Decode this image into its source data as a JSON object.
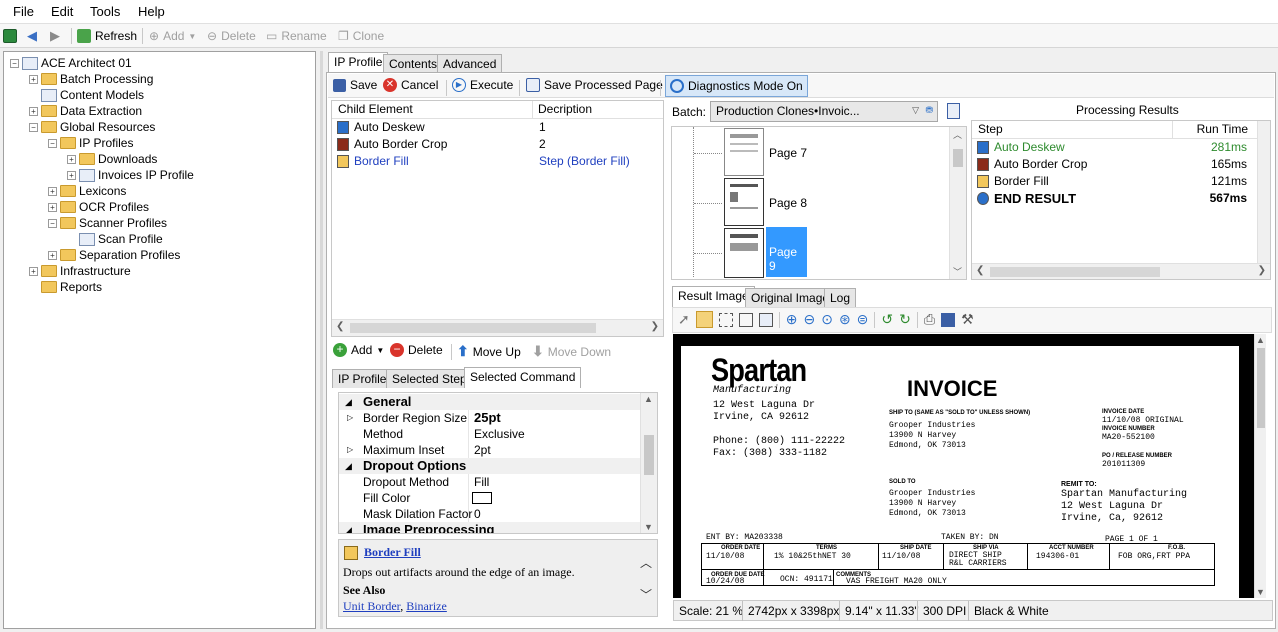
{
  "menu": [
    "File",
    "Edit",
    "Tools",
    "Help"
  ],
  "toolbar": {
    "refresh": "Refresh",
    "add": "Add",
    "delete": "Delete",
    "rename": "Rename",
    "clone": "Clone"
  },
  "tree": [
    {
      "label": "ACE Architect 01",
      "level": 0,
      "expander": "−"
    },
    {
      "label": "Batch Processing",
      "level": 1,
      "expander": "+"
    },
    {
      "label": "Content Models",
      "level": 1,
      "expander": ""
    },
    {
      "label": "Data Extraction",
      "level": 1,
      "expander": "+"
    },
    {
      "label": "Global Resources",
      "level": 1,
      "expander": "−"
    },
    {
      "label": "IP Profiles",
      "level": 2,
      "expander": "−"
    },
    {
      "label": "Downloads",
      "level": 3,
      "expander": "+"
    },
    {
      "label": "Invoices IP Profile",
      "level": 3,
      "expander": "+"
    },
    {
      "label": "Lexicons",
      "level": 2,
      "expander": "+"
    },
    {
      "label": "OCR Profiles",
      "level": 2,
      "expander": "+"
    },
    {
      "label": "Scanner Profiles",
      "level": 2,
      "expander": "−"
    },
    {
      "label": "Scan Profile",
      "level": 3,
      "expander": ""
    },
    {
      "label": "Separation Profiles",
      "level": 2,
      "expander": "+"
    },
    {
      "label": "Infrastructure",
      "level": 1,
      "expander": "+"
    },
    {
      "label": "Reports",
      "level": 1,
      "expander": ""
    }
  ],
  "main_tabs": [
    "IP Profile",
    "Contents",
    "Advanced"
  ],
  "actions": {
    "save": "Save",
    "cancel": "Cancel",
    "execute": "Execute",
    "save_processed": "Save Processed Page",
    "diagnostics": "Diagnostics Mode On"
  },
  "child_grid": {
    "headers": [
      "Child Element",
      "Decription"
    ],
    "rows": [
      {
        "name": "Auto Deskew",
        "desc": "1"
      },
      {
        "name": "Auto Border Crop",
        "desc": "2"
      },
      {
        "name": "Border Fill",
        "desc": "Step (Border Fill)"
      }
    ]
  },
  "step_actions": {
    "add": "Add",
    "delete": "Delete",
    "move_up": "Move Up",
    "move_down": "Move Down"
  },
  "sub_tabs": [
    "IP Profile",
    "Selected Step",
    "Selected Command"
  ],
  "props": [
    {
      "type": "cat",
      "label": "General"
    },
    {
      "type": "prop",
      "label": "Border Region Size",
      "value": "25pt",
      "bold": true,
      "expander": true
    },
    {
      "type": "prop",
      "label": "Method",
      "value": "Exclusive"
    },
    {
      "type": "prop",
      "label": "Maximum Inset",
      "value": "2pt",
      "expander": true
    },
    {
      "type": "cat",
      "label": "Dropout Options"
    },
    {
      "type": "prop",
      "label": "Dropout Method",
      "value": "Fill"
    },
    {
      "type": "prop",
      "label": "Fill Color",
      "value": ""
    },
    {
      "type": "prop",
      "label": "Mask Dilation Factor",
      "value": "0"
    },
    {
      "type": "cat",
      "label": "Image Preprocessing"
    }
  ],
  "help": {
    "title": "Border Fill",
    "desc": "Drops out artifacts around the edge of an image.",
    "see_also": "See Also",
    "link1": "Unit Border",
    "link2": "Binarize",
    "comma": ", "
  },
  "batch": {
    "label": "Batch:",
    "value": "Production Clones•Invoic..."
  },
  "pages": [
    "Page 7",
    "Page 8",
    "Page 9"
  ],
  "results": {
    "title": "Processing Results",
    "headers": [
      "Step",
      "Run Time"
    ],
    "rows": [
      {
        "step": "Auto Deskew",
        "time": "281ms"
      },
      {
        "step": "Auto Border Crop",
        "time": "165ms"
      },
      {
        "step": "Border Fill",
        "time": "121ms"
      },
      {
        "step": "END RESULT",
        "time": "567ms"
      }
    ]
  },
  "image_tabs": [
    "Result Image",
    "Original Image",
    "Log"
  ],
  "status": [
    "Scale: 21 %",
    "2742px x 3398px",
    "9.14\" x 11.33\"",
    "300 DPI",
    "Black & White"
  ],
  "invoice": {
    "company": "Spartan",
    "sub": "Manufacturing",
    "addr1": "12 West Laguna Dr",
    "addr2": "Irvine, CA 92612",
    "phone": "Phone: (800) 111-22222",
    "fax": "Fax:   (308) 333-1182",
    "title": "INVOICE",
    "ship_to_lbl": "SHIP TO (SAME AS \"SOLD TO\" UNLESS SHOWN)",
    "ship1": "Grooper Industries",
    "ship2": "13900 N Harvey",
    "ship3": "Edmond, OK 73013",
    "sold_lbl": "SOLD TO",
    "sold1": "Grooper Industries",
    "sold2": "13900 N Harvey",
    "sold3": "Edmond, OK 73013",
    "inv_date_lbl": "INVOICE DATE",
    "inv_date": "11/10/08 ORIGINAL",
    "inv_num_lbl": "INVOICE NUMBER",
    "inv_num": "MA20-552100",
    "po_lbl": "PO / RELEASE NUMBER",
    "po": "201011309",
    "remit_lbl": "REMIT TO:",
    "remit1": "Spartan Manufacturing",
    "remit2": "12 West Laguna Dr",
    "remit3": "Irvine, Ca, 92612",
    "ent": "ENT BY: MA203338",
    "taken": "TAKEN BY: DN",
    "page": "PAGE 1  OF  1",
    "order_date_lbl": "ORDER DATE",
    "order_date": "11/10/08",
    "terms_lbl": "TERMS",
    "terms": "1% 10&25thNET 30",
    "ship_date_lbl": "SHIP DATE",
    "ship_date": "11/10/08",
    "ship_via_lbl": "SHIP VIA",
    "ship_via1": "DIRECT SHIP",
    "ship_via2": "R&L CARRIERS",
    "acct_lbl": "ACCT NUMBER",
    "acct": "194306-01",
    "fob_lbl": "F.O.B.",
    "fob": "FOB ORG,FRT PPA",
    "odue_lbl": "ORDER DUE DATE",
    "odue": "10/24/08",
    "ocn": "OCN:   491171",
    "comments_lbl": "COMMENTS",
    "vas": "VAS FREIGHT   MA20 ONLY"
  },
  "colors": {
    "accent": "#1f3fbf",
    "selected": "#3399ff",
    "green": "#2e8b2e"
  }
}
